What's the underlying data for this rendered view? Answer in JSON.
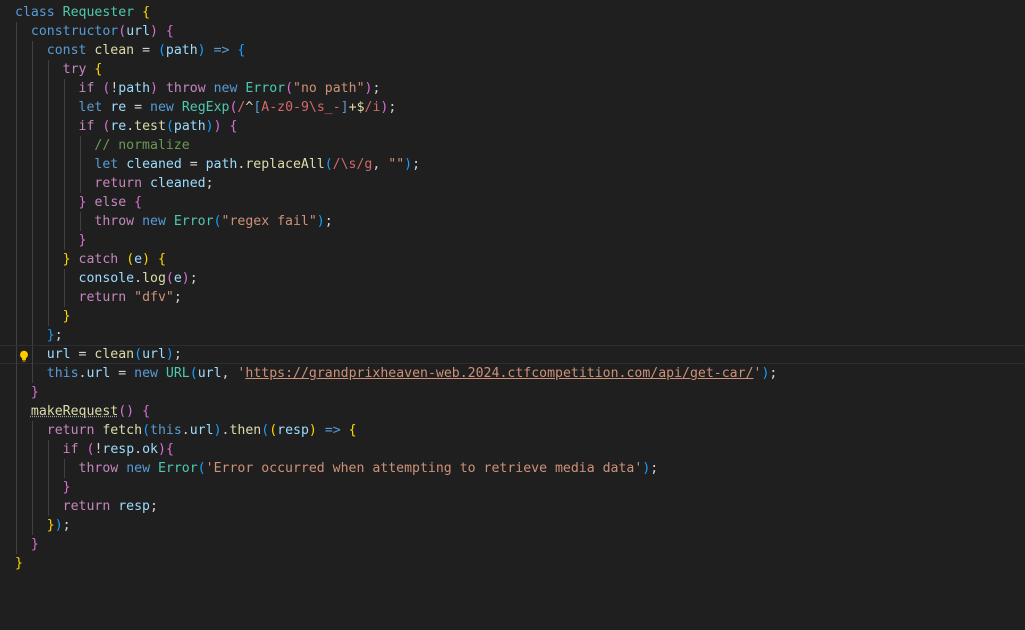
{
  "editor": {
    "language": "javascript",
    "active_line": 18,
    "colors": {
      "background": "#1f1f1f",
      "keyword": "#569cd6",
      "control": "#c586c0",
      "class": "#4ec9b0",
      "function": "#dcdcaa",
      "variable": "#9cdcfe",
      "string": "#ce9178",
      "regex": "#d16969",
      "comment": "#6a9955",
      "bracket_1": "#ffd700",
      "bracket_2": "#da70d6",
      "bracket_3": "#179fff"
    },
    "lightbulb_icon": "lightbulb-icon",
    "lines": [
      {
        "indent": 0,
        "tokens": [
          [
            "kw",
            "class"
          ],
          [
            "op",
            " "
          ],
          [
            "cls",
            "Requester"
          ],
          [
            "op",
            " "
          ],
          [
            "p1",
            "{"
          ]
        ]
      },
      {
        "indent": 1,
        "tokens": [
          [
            "kw",
            "constructor"
          ],
          [
            "p2",
            "("
          ],
          [
            "var",
            "url"
          ],
          [
            "p2",
            ")"
          ],
          [
            "op",
            " "
          ],
          [
            "p2",
            "{"
          ]
        ]
      },
      {
        "indent": 2,
        "tokens": [
          [
            "kw",
            "const"
          ],
          [
            "op",
            " "
          ],
          [
            "fn",
            "clean"
          ],
          [
            "op",
            " = "
          ],
          [
            "p3",
            "("
          ],
          [
            "var",
            "path"
          ],
          [
            "p3",
            ")"
          ],
          [
            "op",
            " "
          ],
          [
            "kw",
            "=>"
          ],
          [
            "op",
            " "
          ],
          [
            "p3",
            "{"
          ]
        ]
      },
      {
        "indent": 3,
        "tokens": [
          [
            "ctl",
            "try"
          ],
          [
            "op",
            " "
          ],
          [
            "p1",
            "{"
          ]
        ]
      },
      {
        "indent": 4,
        "tokens": [
          [
            "ctl",
            "if"
          ],
          [
            "op",
            " "
          ],
          [
            "p2",
            "("
          ],
          [
            "op",
            "!"
          ],
          [
            "var",
            "path"
          ],
          [
            "p2",
            ")"
          ],
          [
            "op",
            " "
          ],
          [
            "ctl",
            "throw"
          ],
          [
            "op",
            " "
          ],
          [
            "kw",
            "new"
          ],
          [
            "op",
            " "
          ],
          [
            "cls",
            "Error"
          ],
          [
            "p2",
            "("
          ],
          [
            "str",
            "\"no path\""
          ],
          [
            "p2",
            ")"
          ],
          [
            "op",
            ";"
          ]
        ]
      },
      {
        "indent": 4,
        "tokens": [
          [
            "kw",
            "let"
          ],
          [
            "op",
            " "
          ],
          [
            "var",
            "re"
          ],
          [
            "op",
            " = "
          ],
          [
            "kw",
            "new"
          ],
          [
            "op",
            " "
          ],
          [
            "cls",
            "RegExp"
          ],
          [
            "p2",
            "("
          ],
          [
            "rx",
            "/"
          ],
          [
            "rxo",
            "^"
          ],
          [
            "kw",
            "["
          ],
          [
            "rx",
            "A-z0-9\\s_-"
          ],
          [
            "kw",
            "]"
          ],
          [
            "rxo",
            "+$"
          ],
          [
            "rx",
            "/i"
          ],
          [
            "p2",
            ")"
          ],
          [
            "op",
            ";"
          ]
        ]
      },
      {
        "indent": 4,
        "tokens": [
          [
            "ctl",
            "if"
          ],
          [
            "op",
            " "
          ],
          [
            "p2",
            "("
          ],
          [
            "var",
            "re"
          ],
          [
            "op",
            "."
          ],
          [
            "fn",
            "test"
          ],
          [
            "p3",
            "("
          ],
          [
            "var",
            "path"
          ],
          [
            "p3",
            ")"
          ],
          [
            "p2",
            ")"
          ],
          [
            "op",
            " "
          ],
          [
            "p2",
            "{"
          ]
        ]
      },
      {
        "indent": 5,
        "tokens": [
          [
            "com",
            "// normalize"
          ]
        ]
      },
      {
        "indent": 5,
        "tokens": [
          [
            "kw",
            "let"
          ],
          [
            "op",
            " "
          ],
          [
            "var",
            "cleaned"
          ],
          [
            "op",
            " = "
          ],
          [
            "var",
            "path"
          ],
          [
            "op",
            "."
          ],
          [
            "fn",
            "replaceAll"
          ],
          [
            "p3",
            "("
          ],
          [
            "rx",
            "/\\s/g"
          ],
          [
            "op",
            ", "
          ],
          [
            "str",
            "\"\""
          ],
          [
            "p3",
            ")"
          ],
          [
            "op",
            ";"
          ]
        ]
      },
      {
        "indent": 5,
        "tokens": [
          [
            "ctl",
            "return"
          ],
          [
            "op",
            " "
          ],
          [
            "var",
            "cleaned"
          ],
          [
            "op",
            ";"
          ]
        ]
      },
      {
        "indent": 4,
        "tokens": [
          [
            "p2",
            "}"
          ],
          [
            "op",
            " "
          ],
          [
            "ctl",
            "else"
          ],
          [
            "op",
            " "
          ],
          [
            "p2",
            "{"
          ]
        ]
      },
      {
        "indent": 5,
        "tokens": [
          [
            "ctl",
            "throw"
          ],
          [
            "op",
            " "
          ],
          [
            "kw",
            "new"
          ],
          [
            "op",
            " "
          ],
          [
            "cls",
            "Error"
          ],
          [
            "p3",
            "("
          ],
          [
            "str",
            "\"regex fail\""
          ],
          [
            "p3",
            ")"
          ],
          [
            "op",
            ";"
          ]
        ]
      },
      {
        "indent": 4,
        "tokens": [
          [
            "p2",
            "}"
          ]
        ]
      },
      {
        "indent": 3,
        "tokens": [
          [
            "p1",
            "}"
          ],
          [
            "op",
            " "
          ],
          [
            "ctl",
            "catch"
          ],
          [
            "op",
            " "
          ],
          [
            "p1",
            "("
          ],
          [
            "var",
            "e"
          ],
          [
            "p1",
            ")"
          ],
          [
            "op",
            " "
          ],
          [
            "p1",
            "{"
          ]
        ]
      },
      {
        "indent": 4,
        "tokens": [
          [
            "var",
            "console"
          ],
          [
            "op",
            "."
          ],
          [
            "fn",
            "log"
          ],
          [
            "p2",
            "("
          ],
          [
            "var",
            "e"
          ],
          [
            "p2",
            ")"
          ],
          [
            "op",
            ";"
          ]
        ]
      },
      {
        "indent": 4,
        "tokens": [
          [
            "ctl",
            "return"
          ],
          [
            "op",
            " "
          ],
          [
            "str",
            "\"dfv\""
          ],
          [
            "op",
            ";"
          ]
        ]
      },
      {
        "indent": 3,
        "tokens": [
          [
            "p1",
            "}"
          ]
        ]
      },
      {
        "indent": 2,
        "tokens": [
          [
            "p3",
            "}"
          ],
          [
            "op",
            ";"
          ]
        ]
      },
      {
        "indent": 2,
        "tokens": [
          [
            "var",
            "url"
          ],
          [
            "op",
            " = "
          ],
          [
            "fn",
            "clean"
          ],
          [
            "p3",
            "("
          ],
          [
            "var",
            "url"
          ],
          [
            "p3",
            ")"
          ],
          [
            "op",
            ";"
          ]
        ]
      },
      {
        "indent": 2,
        "tokens": [
          [
            "kw",
            "this"
          ],
          [
            "op",
            "."
          ],
          [
            "var",
            "url"
          ],
          [
            "op",
            " = "
          ],
          [
            "kw",
            "new"
          ],
          [
            "op",
            " "
          ],
          [
            "cls",
            "URL"
          ],
          [
            "p3",
            "("
          ],
          [
            "var",
            "url"
          ],
          [
            "op",
            ", "
          ],
          [
            "str",
            "'"
          ],
          [
            "url",
            "https://grandprixheaven-web.2024.ctfcompetition.com/api/get-car/"
          ],
          [
            "str",
            "'"
          ],
          [
            "p3",
            ")"
          ],
          [
            "op",
            ";"
          ]
        ]
      },
      {
        "indent": 1,
        "tokens": [
          [
            "p2",
            "}"
          ]
        ]
      },
      {
        "indent": 1,
        "tokens": [
          [
            "fnu",
            "makeRequest"
          ],
          [
            "p2",
            "()"
          ],
          [
            "op",
            " "
          ],
          [
            "p2",
            "{"
          ]
        ]
      },
      {
        "indent": 2,
        "tokens": [
          [
            "ctl",
            "return"
          ],
          [
            "op",
            " "
          ],
          [
            "fn",
            "fetch"
          ],
          [
            "p3",
            "("
          ],
          [
            "kw",
            "this"
          ],
          [
            "op",
            "."
          ],
          [
            "var",
            "url"
          ],
          [
            "p3",
            ")"
          ],
          [
            "op",
            "."
          ],
          [
            "fn",
            "then"
          ],
          [
            "p3",
            "("
          ],
          [
            "p1",
            "("
          ],
          [
            "var",
            "resp"
          ],
          [
            "p1",
            ")"
          ],
          [
            "op",
            " "
          ],
          [
            "kw",
            "=>"
          ],
          [
            "op",
            " "
          ],
          [
            "p1",
            "{"
          ]
        ]
      },
      {
        "indent": 3,
        "tokens": [
          [
            "ctl",
            "if"
          ],
          [
            "op",
            " "
          ],
          [
            "p2",
            "("
          ],
          [
            "op",
            "!"
          ],
          [
            "var",
            "resp"
          ],
          [
            "op",
            "."
          ],
          [
            "var",
            "ok"
          ],
          [
            "p2",
            ")"
          ],
          [
            "p2",
            "{"
          ]
        ]
      },
      {
        "indent": 4,
        "tokens": [
          [
            "ctl",
            "throw"
          ],
          [
            "op",
            " "
          ],
          [
            "kw",
            "new"
          ],
          [
            "op",
            " "
          ],
          [
            "cls",
            "Error"
          ],
          [
            "p3",
            "("
          ],
          [
            "str",
            "'Error occurred when attempting to retrieve media data'"
          ],
          [
            "p3",
            ")"
          ],
          [
            "op",
            ";"
          ]
        ]
      },
      {
        "indent": 3,
        "tokens": [
          [
            "p2",
            "}"
          ]
        ]
      },
      {
        "indent": 3,
        "tokens": [
          [
            "ctl",
            "return"
          ],
          [
            "op",
            " "
          ],
          [
            "var",
            "resp"
          ],
          [
            "op",
            ";"
          ]
        ]
      },
      {
        "indent": 2,
        "tokens": [
          [
            "p1",
            "}"
          ],
          [
            "p3",
            ")"
          ],
          [
            "op",
            ";"
          ]
        ]
      },
      {
        "indent": 1,
        "tokens": [
          [
            "p2",
            "}"
          ]
        ]
      },
      {
        "indent": 0,
        "tokens": [
          [
            "p1",
            "}"
          ]
        ]
      }
    ]
  }
}
